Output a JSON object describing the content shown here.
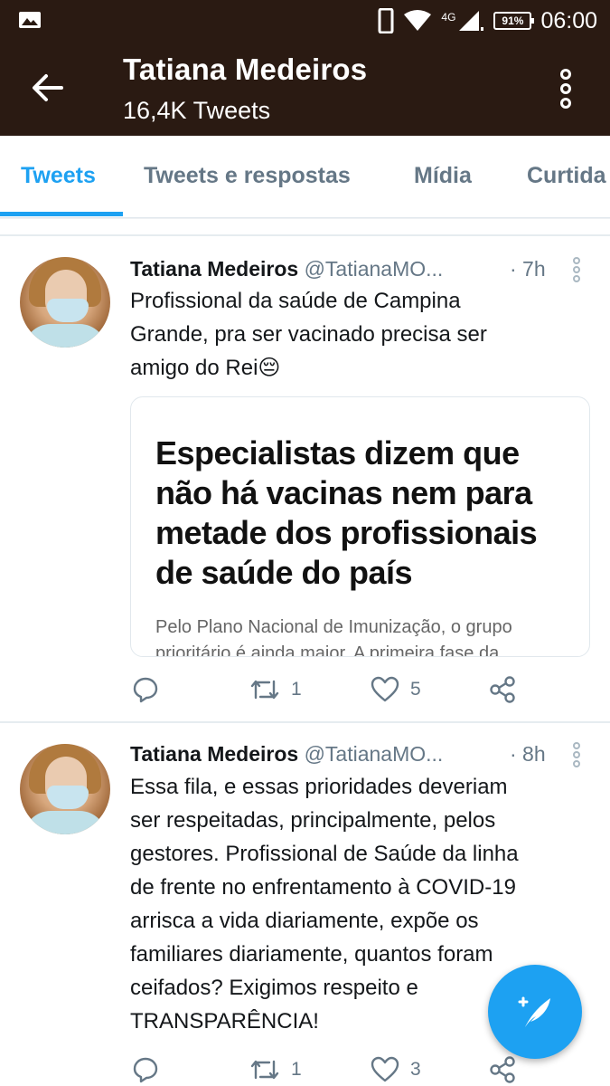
{
  "status_bar": {
    "network": "4G",
    "battery": "91%",
    "time": "06:00",
    "icons": [
      "image-icon",
      "phone-icon",
      "wifi-icon",
      "signal-icon",
      "battery-icon"
    ]
  },
  "header": {
    "title": "Tatiana Medeiros",
    "subtitle": "16,4K Tweets"
  },
  "tabs": [
    {
      "label": "Tweets",
      "active": true
    },
    {
      "label": "Tweets e respostas",
      "active": false
    },
    {
      "label": "Mídia",
      "active": false
    },
    {
      "label": "Curtida",
      "active": false
    }
  ],
  "tweets": [
    {
      "name": "Tatiana Medeiros",
      "handle": "@TatianaMO...",
      "time": "· 7h",
      "lines": [
        "Profissional da saúde de Campina",
        "Grande, pra ser vacinado precisa ser",
        "amigo do Rei😔"
      ],
      "card": {
        "headline": "Especialistas dizem que não há vacinas nem para metade dos profissionais de saúde do país",
        "snippet": "Pelo Plano Nacional de Imunização, o grupo prioritário é ainda maior. A primeira fase da"
      },
      "reply_count": "",
      "retweet_count": "1",
      "like_count": "5"
    },
    {
      "name": "Tatiana Medeiros",
      "handle": "@TatianaMO...",
      "time": "· 8h",
      "lines": [
        "Essa fila, e essas prioridades deveriam",
        "ser respeitadas, principalmente, pelos",
        "gestores. Profissional de Saúde da linha",
        "de frente no enfrentamento à COVID-19",
        "arrisca a vida diariamente, expõe os",
        "familiares diariamente, quantos foram",
        "ceifados? Exigimos respeito e",
        "TRANSPARÊNCIA!"
      ],
      "reply_count": "",
      "retweet_count": "1",
      "like_count": "3"
    }
  ],
  "colors": {
    "header_bg": "#2a1a12",
    "accent": "#1da1f2",
    "secondary_text": "#657786"
  }
}
